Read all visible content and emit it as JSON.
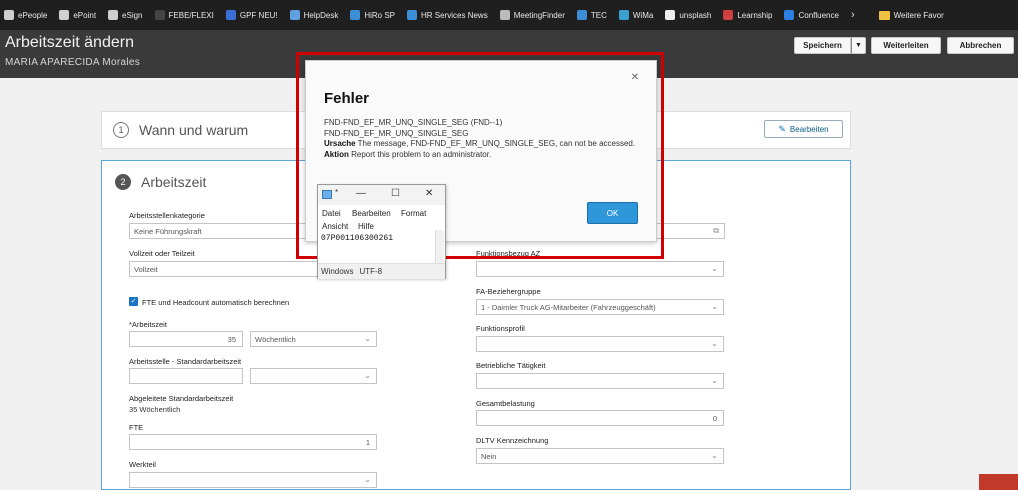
{
  "bookmarks": [
    {
      "label": "ePeople",
      "icon": "epeople-icon",
      "color": "#cfcfcf"
    },
    {
      "label": "ePoint",
      "icon": "epoint-icon",
      "color": "#cfcfcf"
    },
    {
      "label": "eSign",
      "icon": "esign-icon",
      "color": "#cfcfcf"
    },
    {
      "label": "FEBE/FLEXI",
      "icon": "febe-icon",
      "color": "#444444"
    },
    {
      "label": "GPF NEU!",
      "icon": "gpf-icon",
      "color": "#3b6fd8"
    },
    {
      "label": "HelpDesk",
      "icon": "helpdesk-icon",
      "color": "#5fa0e0"
    },
    {
      "label": "HiRo SP",
      "icon": "hiro-icon",
      "color": "#3c8fd6"
    },
    {
      "label": "HR Services News",
      "icon": "hr-news-icon",
      "color": "#3c8fd6"
    },
    {
      "label": "MeetingFinder",
      "icon": "meetingfinder-icon",
      "color": "#bbbbbb"
    },
    {
      "label": "TEC",
      "icon": "tec-icon",
      "color": "#3c8fd6"
    },
    {
      "label": "WiMa",
      "icon": "wima-icon",
      "color": "#3aa0d0"
    },
    {
      "label": "unsplash",
      "icon": "unsplash-icon",
      "color": "#eeeeee"
    },
    {
      "label": "Learnship",
      "icon": "learnship-icon",
      "color": "#d04040"
    },
    {
      "label": "Confluence",
      "icon": "confluence-icon",
      "color": "#2d7fe0"
    }
  ],
  "bookmarks_more": "Weitere Favor",
  "header": {
    "title": "Arbeitszeit ändern",
    "person": "MARIA APARECIDA Morales",
    "save_label": "Speichern",
    "forward_label": "Weiterleiten",
    "cancel_label": "Abbrechen"
  },
  "section1": {
    "number": "1",
    "title": "Wann und warum",
    "edit_label": "Bearbeiten"
  },
  "section2": {
    "number": "2",
    "title": "Arbeitszeit",
    "labels": {
      "job_category": "Arbeitsstellenkategorie",
      "full_part": "Vollzeit oder Teilzeit",
      "fte_checkbox": "FTE und Headcount automatisch berechnen",
      "working_time": "*Arbeitszeit",
      "std_time": "Arbeitsstelle - Standardarbeitszeit",
      "derived_std": "Abgeleitete Standardarbeitszeit",
      "fte": "FTE",
      "part": "Werkteil",
      "function_ref": "Funktionsbezug AZ",
      "fa_group": "FA-Beziehergruppe",
      "function_profile": "Funktionsprofil",
      "activity": "Betriebliche Tätigkeit",
      "total_load": "Gesamtbelastung",
      "dltv": "DLTV Kennzeichnung"
    },
    "values": {
      "job_category": "Keine Führungskraft",
      "full_part": "Vollzeit",
      "working_time_hours": "35",
      "working_time_unit": "Wöchentlich",
      "derived_std": "35 Wöchentlich",
      "fte": "1",
      "fa_group": "1 - Daimler Truck AG-Mitarbeiter (Fahrzeuggeschäft)",
      "total_load": "0",
      "dltv": "Nein"
    }
  },
  "error_dialog": {
    "title": "Fehler",
    "line1": "FND-FND_EF_MR_UNQ_SINGLE_SEG (FND--1)",
    "line2": "FND-FND_EF_MR_UNQ_SINGLE_SEG",
    "cause_label": "Ursache",
    "cause_text": " The message, FND-FND_EF_MR_UNQ_SINGLE_SEG, can not be accessed.",
    "action_label": "Aktion",
    "action_text": " Report this problem to an administrator.",
    "ok_label": "OK"
  },
  "notepad": {
    "title": "*",
    "menu": [
      "Datei",
      "Bearbeiten",
      "Format",
      "Ansicht",
      "Hilfe"
    ],
    "content": "07P001106300261",
    "status_eol": "Windows",
    "status_encoding": "UTF-8"
  },
  "colors": {
    "accent": "#2e97d9",
    "annotation": "#d00000",
    "header_bg": "#3a3a3a"
  }
}
